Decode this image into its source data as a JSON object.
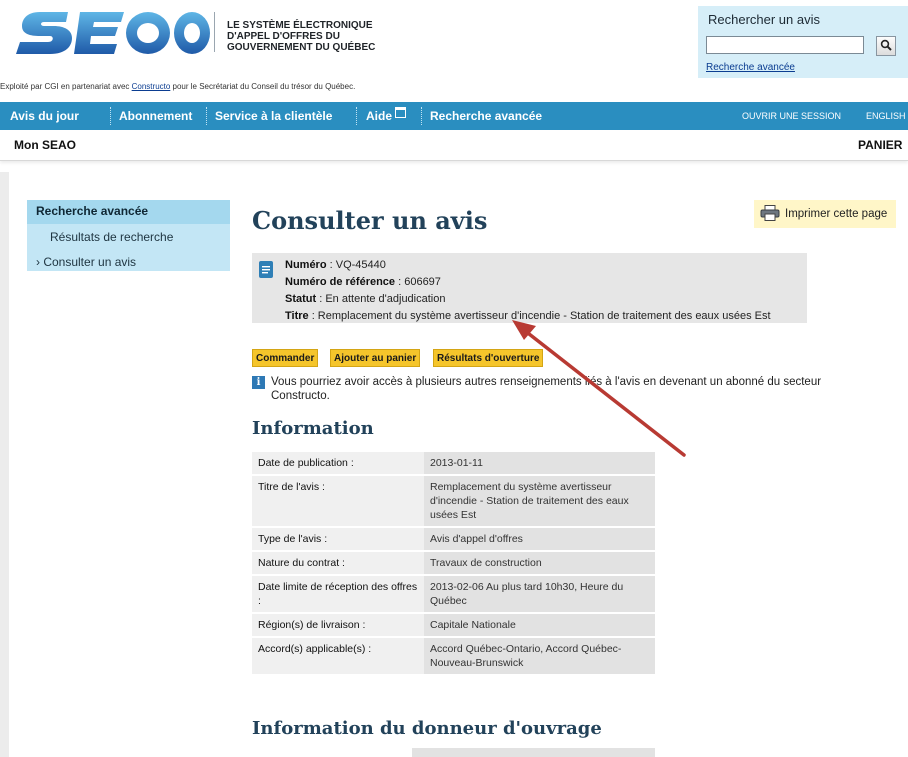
{
  "header": {
    "logo_text": "SEAO",
    "gov_name_lines": [
      "LE SYSTÈME ÉLECTRONIQUE",
      "D'APPEL D'OFFRES DU",
      "GOUVERNEMENT DU QUÉBEC"
    ],
    "operated_prefix": "Exploité par CGI en partenariat avec ",
    "operated_link": "Constructo",
    "operated_suffix": " pour le Secrétariat du Conseil du trésor du Québec."
  },
  "search": {
    "title": "Rechercher un avis",
    "value": "",
    "advanced_link": "Recherche avancée"
  },
  "nav": {
    "items": [
      "Avis du jour",
      "Abonnement",
      "Service à la clientèle",
      "Aide",
      "Recherche avancée"
    ],
    "login": "OUVRIR UNE SESSION",
    "language": "ENGLISH"
  },
  "subnav": {
    "left": "Mon SEAO",
    "right": "PANIER"
  },
  "sidebar": {
    "title": "Recherche avancée",
    "items": [
      "Résultats de recherche",
      "› Consulter un avis"
    ]
  },
  "main": {
    "title": "Consulter un avis",
    "print_label": "Imprimer cette page",
    "summary": {
      "numero_label": "Numéro",
      "numero": " : VQ-45440",
      "ref_label": "Numéro de référence",
      "ref": " : 606697",
      "statut_label": "Statut",
      "statut": " : En attente d'adjudication",
      "titre_label": "Titre",
      "titre": " : Remplacement du système avertisseur d'incendie - Station de traitement des eaux usées Est"
    },
    "buttons": [
      "Commander",
      "Ajouter au panier",
      "Résultats d'ouverture"
    ],
    "info_text": "Vous pourriez avoir accès à plusieurs autres renseignements liés à l'avis en devenant un abonné du secteur Constructo.",
    "section_information": "Information",
    "section_donneur": "Information du donneur d'ouvrage",
    "table": [
      {
        "label": "Date de publication :",
        "value": "2013-01-11"
      },
      {
        "label": "Titre de l'avis :",
        "value": "Remplacement du système avertisseur d'incendie - Station de traitement des eaux usées Est"
      },
      {
        "label": "Type de l'avis :",
        "value": "Avis d'appel d'offres"
      },
      {
        "label": "Nature du contrat :",
        "value": "Travaux de construction"
      },
      {
        "label": "Date limite de réception des offres :",
        "value": "2013-02-06 Au plus tard 10h30, Heure du Québec"
      },
      {
        "label": "Région(s) de livraison :",
        "value": "Capitale Nationale"
      },
      {
        "label": "Accord(s) applicable(s) :",
        "value": "Accord Québec-Ontario, Accord Québec-Nouveau-Brunswick"
      }
    ]
  },
  "colors": {
    "nav_blue": "#2a8ec0",
    "sidebar_blue": "#c3e6f5",
    "title_navy": "#22425a",
    "button_yellow": "#f5c52b",
    "arrow_red": "#b83a33"
  }
}
